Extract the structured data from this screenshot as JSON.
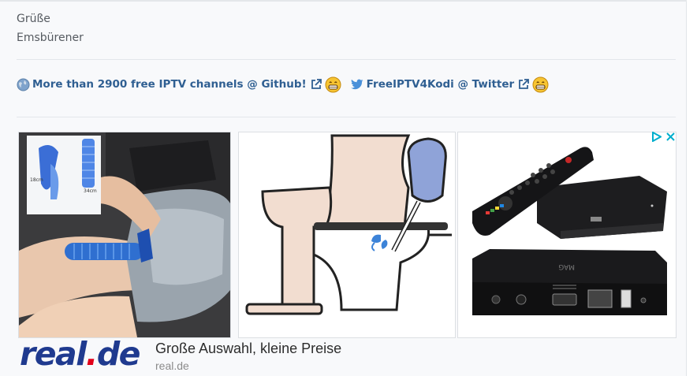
{
  "signature": {
    "greeting": "Grüße",
    "name": "Emsbürener"
  },
  "links": {
    "iptv_label": "More than 2900 free IPTV channels @ Github!",
    "twitter_label": "FreeIPTV4Kodi @ Twitter"
  },
  "ad": {
    "headline": "Große Auswahl, kleine Preise",
    "domain": "real.de",
    "logo_main": "real",
    "logo_dot": ".",
    "logo_tld": "de",
    "tile1_label_a": "18cm",
    "tile1_label_b": "34cm",
    "tile3_device_text": "MAG",
    "brand_colors": {
      "logo_blue": "#1f3a8f",
      "logo_red": "#e2001a",
      "adchoices": "#00aecd"
    }
  },
  "icons": [
    "globe-icon",
    "external-link-icon",
    "grin-emoji-icon",
    "twitter-bird-icon",
    "adchoices-icon",
    "close-icon"
  ]
}
